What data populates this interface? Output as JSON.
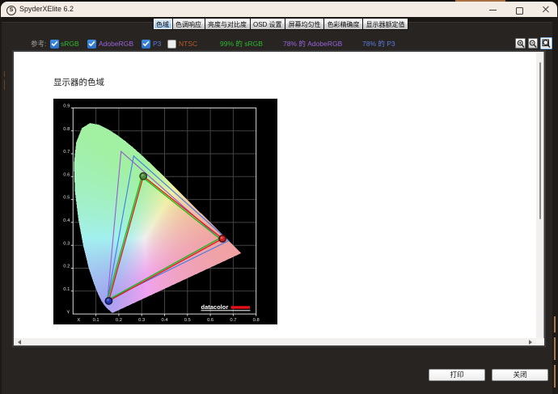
{
  "window": {
    "title": "SpyderXElite 6.2",
    "logo_letter": "S",
    "controls": {
      "minimize": "minimize",
      "maximize": "maximize",
      "close": "close"
    }
  },
  "tabs": [
    {
      "label": "色域",
      "selected": true
    },
    {
      "label": "色调响应",
      "selected": false
    },
    {
      "label": "亮度与对比度",
      "selected": false
    },
    {
      "label": "OSD 设置",
      "selected": false
    },
    {
      "label": "屏幕均匀性",
      "selected": false
    },
    {
      "label": "色彩精确度",
      "selected": false
    },
    {
      "label": "显示器额定值",
      "selected": false
    }
  ],
  "toolbar": {
    "reference_label": "参考:",
    "checkboxes": [
      {
        "label": "sRGB",
        "checked": true,
        "color": "#2db92d"
      },
      {
        "label": "AdobeRGB",
        "checked": true,
        "color": "#9a63dc"
      },
      {
        "label": "P3",
        "checked": true,
        "color": "#5b7ade"
      },
      {
        "label": "NTSC",
        "checked": false,
        "color": "#b85c2a"
      }
    ],
    "results": [
      {
        "text": "99% 的 sRGB",
        "color": "#2db92d"
      },
      {
        "text": "78% 的 AdobeRGB",
        "color": "#9a63dc"
      },
      {
        "text": "78% 的 P3",
        "color": "#5b7ade"
      }
    ],
    "accent_checkbox": "#2e7bd8",
    "zoom_tools": [
      {
        "name": "zoom-in",
        "active": false
      },
      {
        "name": "zoom-out",
        "active": false
      },
      {
        "name": "zoom-fit",
        "active": true
      }
    ]
  },
  "document": {
    "heading": "显示器的色域"
  },
  "footer": {
    "print_label": "打印",
    "close_label": "关闭"
  },
  "chart_data": {
    "type": "chromaticity-gamut",
    "title": "显示器的色域",
    "xlabel": "X",
    "ylabel": "Y",
    "xlim": [
      0,
      0.8
    ],
    "ylim": [
      0,
      0.9
    ],
    "x_ticks": [
      0.1,
      0.2,
      0.3,
      0.4,
      0.5,
      0.6,
      0.7,
      0.8
    ],
    "y_ticks": [
      0.1,
      0.2,
      0.3,
      0.4,
      0.5,
      0.6,
      0.7,
      0.8,
      0.9
    ],
    "grid": true,
    "background": "#000000",
    "gamuts": [
      {
        "name": "AdobeRGB",
        "color": "#9a5ad2",
        "width": 1.1,
        "markers": false,
        "vertices": [
          [
            0.64,
            0.33
          ],
          [
            0.21,
            0.71
          ],
          [
            0.15,
            0.06
          ]
        ]
      },
      {
        "name": "P3",
        "color": "#3f7de2",
        "width": 1.1,
        "markers": false,
        "vertices": [
          [
            0.68,
            0.32
          ],
          [
            0.265,
            0.69
          ],
          [
            0.15,
            0.06
          ]
        ]
      },
      {
        "name": "sRGB",
        "color": "#10c010",
        "width": 1.3,
        "markers": false,
        "vertices": [
          [
            0.64,
            0.33
          ],
          [
            0.3,
            0.6
          ],
          [
            0.15,
            0.06
          ]
        ]
      },
      {
        "name": "display",
        "color": "#e41818",
        "width": 1.3,
        "markers": true,
        "vertices": [
          [
            0.653,
            0.329
          ],
          [
            0.307,
            0.602
          ],
          [
            0.156,
            0.057
          ]
        ],
        "marker_fills": [
          "#c92121",
          "#4c8c38",
          "#2a35b5"
        ],
        "marker_rings": [
          "#420c0c",
          "#233f14",
          "#0d1342"
        ]
      }
    ],
    "logo": {
      "text": "datacolor",
      "bar_color": "#e8101c"
    },
    "spectral_locus": [
      [
        0.1741,
        0.005
      ],
      [
        0.174,
        0.005
      ],
      [
        0.1738,
        0.0049
      ],
      [
        0.1736,
        0.0049
      ],
      [
        0.1733,
        0.0048
      ],
      [
        0.173,
        0.0048
      ],
      [
        0.1726,
        0.0048
      ],
      [
        0.1721,
        0.0048
      ],
      [
        0.1714,
        0.0051
      ],
      [
        0.1703,
        0.0058
      ],
      [
        0.1689,
        0.0069
      ],
      [
        0.1669,
        0.0086
      ],
      [
        0.1644,
        0.0109
      ],
      [
        0.1611,
        0.0138
      ],
      [
        0.1566,
        0.0177
      ],
      [
        0.151,
        0.0227
      ],
      [
        0.144,
        0.0297
      ],
      [
        0.1355,
        0.0399
      ],
      [
        0.1241,
        0.0578
      ],
      [
        0.1096,
        0.0868
      ],
      [
        0.0913,
        0.1327
      ],
      [
        0.0687,
        0.2007
      ],
      [
        0.0454,
        0.295
      ],
      [
        0.0235,
        0.4127
      ],
      [
        0.0082,
        0.5384
      ],
      [
        0.0039,
        0.6548
      ],
      [
        0.0139,
        0.7502
      ],
      [
        0.0389,
        0.812
      ],
      [
        0.0743,
        0.8338
      ],
      [
        0.1142,
        0.8262
      ],
      [
        0.1547,
        0.8059
      ],
      [
        0.1929,
        0.7816
      ],
      [
        0.2296,
        0.7543
      ],
      [
        0.2658,
        0.7243
      ],
      [
        0.3016,
        0.6923
      ],
      [
        0.3373,
        0.6589
      ],
      [
        0.3731,
        0.6245
      ],
      [
        0.4087,
        0.5896
      ],
      [
        0.4441,
        0.5547
      ],
      [
        0.4788,
        0.5202
      ],
      [
        0.5125,
        0.4866
      ],
      [
        0.5448,
        0.4544
      ],
      [
        0.5752,
        0.4242
      ],
      [
        0.6029,
        0.3965
      ],
      [
        0.627,
        0.3725
      ],
      [
        0.6482,
        0.3514
      ],
      [
        0.6658,
        0.334
      ],
      [
        0.6801,
        0.3197
      ],
      [
        0.6915,
        0.3083
      ],
      [
        0.7006,
        0.2993
      ],
      [
        0.7079,
        0.292
      ],
      [
        0.714,
        0.2859
      ],
      [
        0.719,
        0.2809
      ],
      [
        0.723,
        0.277
      ],
      [
        0.726,
        0.274
      ],
      [
        0.7283,
        0.2717
      ],
      [
        0.73,
        0.27
      ],
      [
        0.7311,
        0.2689
      ],
      [
        0.732,
        0.268
      ],
      [
        0.7327,
        0.2673
      ],
      [
        0.7334,
        0.2666
      ],
      [
        0.734,
        0.266
      ],
      [
        0.7344,
        0.2656
      ],
      [
        0.7347,
        0.2653
      ]
    ]
  }
}
